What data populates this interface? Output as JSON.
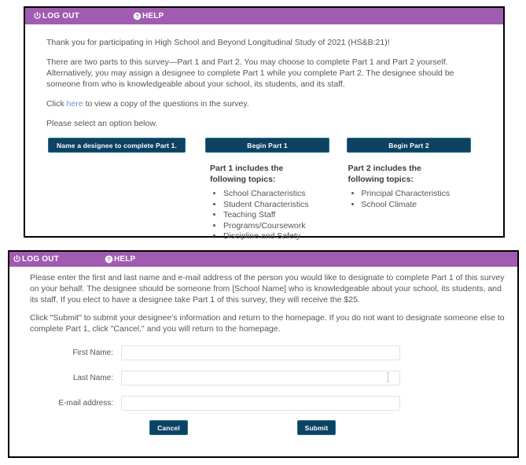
{
  "theme": {
    "accent_purple": "#a05cb0",
    "button_navy": "#0d4263",
    "link_blue": "#5b9bd5",
    "text_gray": "#53565a",
    "border_black": "#000000"
  },
  "home_panel": {
    "appbar": {
      "logout_label": "LOG OUT",
      "logout_icon": "power-icon",
      "help_label": "HELP",
      "help_icon": "question-circle-icon"
    },
    "paragraphs": {
      "thanks": "Thank you for participating in High School and Beyond Longitudinal Study of 2021 (HS&B:21)!",
      "two_parts": "There are two parts to this survey—Part 1 and Part 2. You may choose to complete Part 1 and Part 2 yourself. Alternatively, you may assign a designee to complete Part 1 while you complete Part 2. The designee should be someone from who is knowledgeable about your school, its students, and its staff.",
      "click_prefix": "Click ",
      "click_link": "here",
      "click_suffix": " to view a copy of the questions in the survey.",
      "select_option": "Please select an option below."
    },
    "buttons": {
      "designee": "Name a designee to complete Part 1.",
      "begin_part1": "Begin Part 1",
      "begin_part2": "Begin Part 2"
    },
    "topics": [
      {
        "heading": "Part 1 includes the following topics:",
        "items": [
          "School Characteristics",
          "Student Characteristics",
          "Teaching Staff",
          "Programs/Coursework",
          "Discipline and Safety"
        ]
      },
      {
        "heading": "Part 2 includes the following topics:",
        "items": [
          "Principal Characteristics",
          "School Climate"
        ]
      }
    ]
  },
  "designee_panel": {
    "appbar": {
      "logout_label": "LOG OUT",
      "logout_icon": "power-icon",
      "help_label": "HELP",
      "help_icon": "question-circle-icon"
    },
    "paragraphs": {
      "intro": "Please enter the first and last name and e-mail address of the person you would like to designate to complete Part 1 of this survey on your behalf. The designee should be someone from [School Name] who is knowledgeable about your school, its students, and its staff. If you elect to have a designee take Part 1 of this survey, they will receive the $25.",
      "submit_info": "Click \"Submit\" to submit your designee's information and return to the homepage. If you do not want to designate someone else to complete Part 1, click \"Cancel,\" and you will return to the homepage."
    },
    "form": {
      "fields": [
        {
          "label": "First Name:",
          "value": "",
          "placeholder": ""
        },
        {
          "label": "Last Name:",
          "value": "",
          "placeholder": ""
        },
        {
          "label": "E-mail address:",
          "value": "",
          "placeholder": ""
        }
      ],
      "cancel_label": "Cancel",
      "submit_label": "Submit"
    }
  }
}
